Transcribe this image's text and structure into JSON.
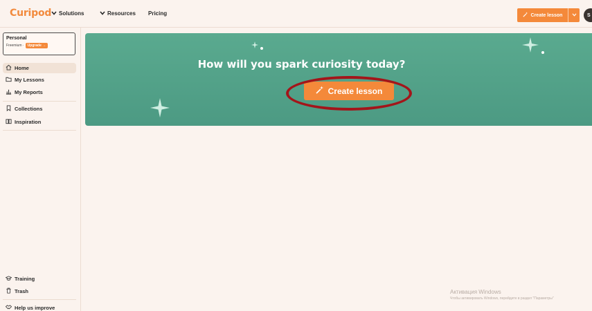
{
  "app": {
    "logo": "Curipod"
  },
  "topnav": {
    "items": [
      {
        "label": "Solutions"
      },
      {
        "label": "Resources"
      },
      {
        "label": "Pricing"
      }
    ],
    "create_lesson_label": "Create lesson",
    "avatar_initial": "S"
  },
  "sidebar": {
    "plan": {
      "name": "Personal",
      "tier": "Freemium ·",
      "upgrade_label": "Upgrade"
    },
    "items": [
      {
        "label": "Home",
        "icon": "home-icon"
      },
      {
        "label": "My Lessons",
        "icon": "folder-icon"
      },
      {
        "label": "My Reports",
        "icon": "bar-chart-icon"
      },
      {
        "label": "Collections",
        "icon": "bookmark-icon"
      },
      {
        "label": "Inspiration",
        "icon": "book-open-icon"
      }
    ],
    "bottom_items": [
      {
        "label": "Training",
        "icon": "graduation-cap-icon"
      },
      {
        "label": "Trash",
        "icon": "trash-icon"
      },
      {
        "label": "Help us improve",
        "icon": "handshake-icon"
      }
    ]
  },
  "hero": {
    "title": "How will you spark curiosity today?",
    "button_label": "Create lesson"
  },
  "watermark": {
    "title": "Активация Windows",
    "subtitle": "Чтобы активировать Windows, перейдите в раздел \"Параметры\""
  },
  "colors": {
    "accent": "#f4893a",
    "hero_bg": "#55a58b",
    "page_bg": "#fbf3ee",
    "highlight_ring": "#a3151a"
  }
}
